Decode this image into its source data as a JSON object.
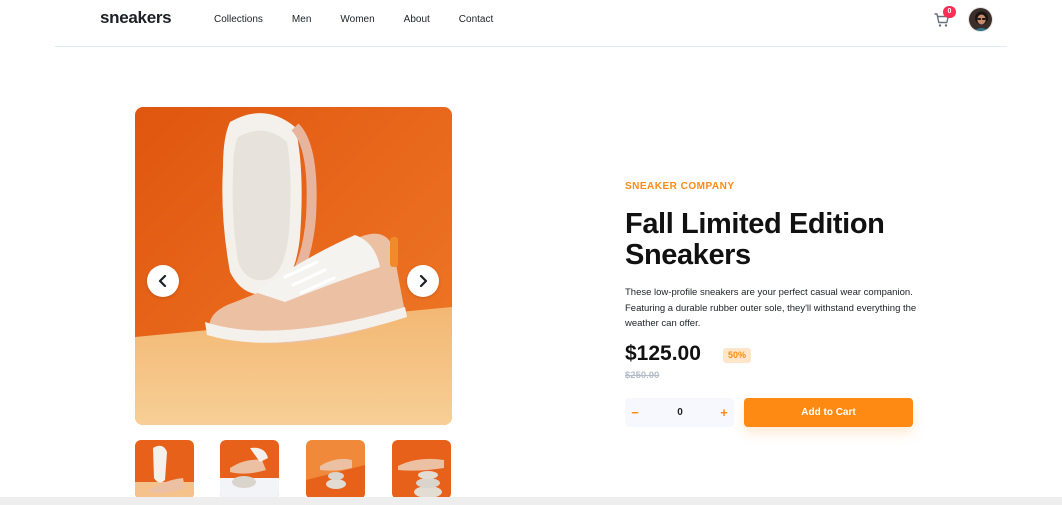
{
  "header": {
    "logo": "sneakers",
    "nav": [
      "Collections",
      "Men",
      "Women",
      "About",
      "Contact"
    ],
    "cart_count": "0",
    "cart_icon": "cart-icon",
    "avatar_icon": "avatar"
  },
  "gallery": {
    "prev_icon": "chevron-left-icon",
    "next_icon": "chevron-right-icon",
    "thumbnail_count": 4
  },
  "product": {
    "company": "SNEAKER COMPANY",
    "title": "Fall Limited Edition Sneakers",
    "description": "These low-profile sneakers are your perfect casual wear companion. Featuring a durable rubber outer sole, they'll withstand everything the weather can offer.",
    "price": "$125.00",
    "discount": "50%",
    "old_price": "$250.00"
  },
  "purchase": {
    "minus_label": "−",
    "quantity": "0",
    "plus_label": "+",
    "add_to_cart_label": "Add to Cart"
  },
  "colors": {
    "accent": "#ff8a13",
    "accent_pale": "#ffe6ca",
    "badge": "#ff2d55",
    "dark_text": "#1d2026"
  }
}
